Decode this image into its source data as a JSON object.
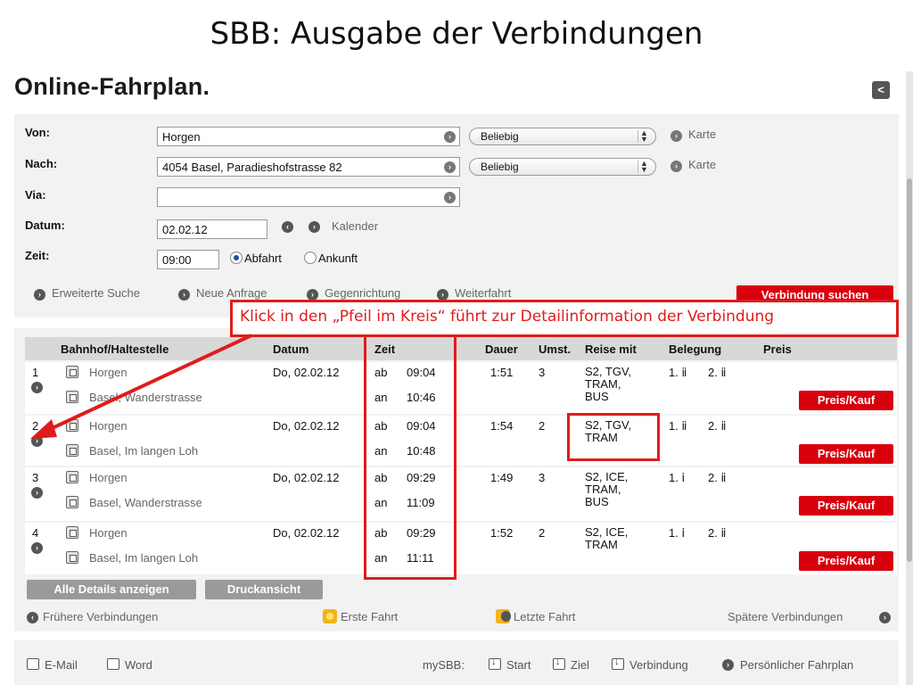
{
  "slide": {
    "title": "SBB: Ausgabe der Verbindungen"
  },
  "page": {
    "heading": "Online-Fahrplan."
  },
  "form": {
    "from_label": "Von:",
    "from_value": "Horgen",
    "to_label": "Nach:",
    "to_value": "4054 Basel, Paradieshofstrasse 82",
    "via_label": "Via:",
    "via_value": "",
    "date_label": "Datum:",
    "date_value": "02.02.12",
    "calendar_label": "Kalender",
    "time_label": "Zeit:",
    "time_value": "09:00",
    "departure_label": "Abfahrt",
    "arrival_label": "Ankunft",
    "select_any_label": "Beliebig",
    "map_label": "Karte",
    "extended_search": "Erweiterte Suche",
    "new_query": "Neue Anfrage",
    "reverse_direction": "Gegenrichtung",
    "continue_journey": "Weiterfahrt",
    "search_button": "Verbindung suchen"
  },
  "annotation": {
    "callout": "Klick in den „Pfeil im Kreis“ führt zur Detailinformation der Verbindung"
  },
  "results": {
    "headers": [
      "Bahnhof/Haltestelle",
      "Datum",
      "Zeit",
      "Dauer",
      "Umst.",
      "Reise mit",
      "Belegung",
      "Preis"
    ],
    "rows": [
      {
        "num": "1",
        "from": "Horgen",
        "to": "Basel, Wanderstrasse",
        "date": "Do, 02.02.12",
        "dep_label": "ab",
        "dep": "09:04",
        "arr_label": "an",
        "arr": "10:46",
        "duration": "1:51",
        "changes": "3",
        "travel": "S2, TGV,\nTRAM,\nBUS",
        "occ1": "1.",
        "occ1_icon": "ⅱ",
        "occ2": "2.",
        "occ2_icon": "ⅱ",
        "price": "Preis/Kauf"
      },
      {
        "num": "2",
        "from": "Horgen",
        "to": "Basel, Im langen Loh",
        "date": "Do, 02.02.12",
        "dep_label": "ab",
        "dep": "09:04",
        "arr_label": "an",
        "arr": "10:48",
        "duration": "1:54",
        "changes": "2",
        "travel": "S2, TGV,\nTRAM",
        "occ1": "1.",
        "occ1_icon": "ⅱ",
        "occ2": "2.",
        "occ2_icon": "ⅱ",
        "price": "Preis/Kauf"
      },
      {
        "num": "3",
        "from": "Horgen",
        "to": "Basel, Wanderstrasse",
        "date": "Do, 02.02.12",
        "dep_label": "ab",
        "dep": "09:29",
        "arr_label": "an",
        "arr": "11:09",
        "duration": "1:49",
        "changes": "3",
        "travel": "S2, ICE,\nTRAM,\nBUS",
        "occ1": "1.",
        "occ1_icon": "ⅰ",
        "occ2": "2.",
        "occ2_icon": "ⅱ",
        "price": "Preis/Kauf"
      },
      {
        "num": "4",
        "from": "Horgen",
        "to": "Basel, Im langen Loh",
        "date": "Do, 02.02.12",
        "dep_label": "ab",
        "dep": "09:29",
        "arr_label": "an",
        "arr": "11:11",
        "duration": "1:52",
        "changes": "2",
        "travel": "S2, ICE,\nTRAM",
        "occ1": "1.",
        "occ1_icon": "ⅰ",
        "occ2": "2.",
        "occ2_icon": "ⅱ",
        "price": "Preis/Kauf"
      }
    ],
    "show_all_details": "Alle Details anzeigen",
    "print_view": "Druckansicht",
    "earlier": "Frühere Verbindungen",
    "first_trip": "Erste Fahrt",
    "last_trip": "Letzte Fahrt",
    "later": "Spätere Verbindungen"
  },
  "footer": {
    "email": "E-Mail",
    "word": "Word",
    "mysbb": "mySBB:",
    "start": "Start",
    "destination": "Ziel",
    "connection": "Verbindung",
    "personal_timetable": "Persönlicher Fahrplan"
  },
  "colors": {
    "sbb_red": "#d9000d",
    "annotation_red": "#e11b1b",
    "panel_grey": "#f2f2f2"
  },
  "icons": [
    "share-icon",
    "circle-arrow-icon",
    "station-icon",
    "sun-icon",
    "moon-icon",
    "mail-icon",
    "word-icon",
    "download-icon"
  ]
}
